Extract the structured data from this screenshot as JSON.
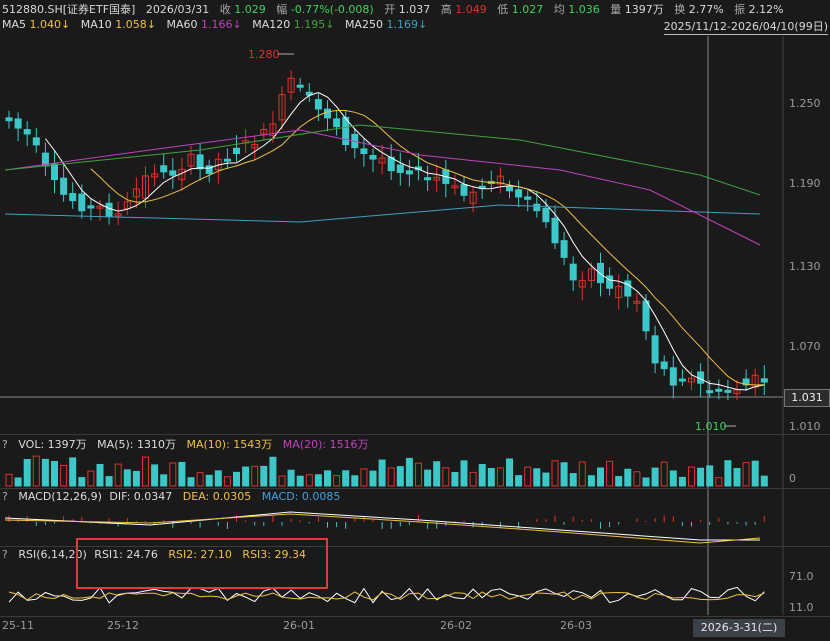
{
  "header": {
    "symbol": "512880.SH[证券ETF国泰]",
    "date": "2026/03/31",
    "close_label": "收",
    "close": "1.029",
    "change_label": "幅",
    "change": "-0.77%(-0.008)",
    "open_label": "开",
    "open": "1.037",
    "high_label": "高",
    "high": "1.049",
    "low_label": "低",
    "low": "1.027",
    "avg_label": "均",
    "avg": "1.036",
    "volume_label": "量",
    "volume": "1397万",
    "turnover_label": "换",
    "turnover": "2.77%",
    "amplitude_label": "振",
    "amplitude": "2.12%"
  },
  "ma_bar": {
    "ma5": "MA5",
    "ma5_val": "1.040↓",
    "ma10": "MA10",
    "ma10_val": "1.058↓",
    "ma60": "MA60",
    "ma60_val": "1.166↓",
    "ma120": "MA120",
    "ma120_val": "1.195↓",
    "ma250": "MA250",
    "ma250_val": "1.169↓",
    "range": "2025/11/12-2026/04/10(99日)"
  },
  "price_axis": [
    "1.250",
    "1.190",
    "1.130",
    "1.070",
    "1.010"
  ],
  "last_price_tag": "1.031",
  "hi_label": "1.280",
  "lo_label": "1.010",
  "volume_panel": {
    "title": "VOL: 1397万",
    "ma5": "MA(5): 1310万",
    "ma10": "MA(10): 1543万",
    "ma20": "MA(20): 1516万",
    "axis_zero": "0"
  },
  "macd_panel": {
    "title": "MACD(12,26,9)",
    "dif": "DIF: 0.0347",
    "dea": "DEA: 0.0305",
    "macd": "MACD: 0.0085"
  },
  "rsi_panel": {
    "title": "RSI(6,14,20)",
    "rsi1": "RSI1: 24.76",
    "rsi2": "RSI2: 27.10",
    "rsi3": "RSI3: 29.34",
    "axis_top": "71.0",
    "axis_bottom": "11.0"
  },
  "x_axis": [
    "25-11",
    "25-12",
    "26-01",
    "26-02",
    "26-03"
  ],
  "cursor_date": "2026-3-31(二)",
  "colors": {
    "up": "#e0312a",
    "down": "#3cc8c8",
    "ma5": "#ffffff",
    "ma10": "#f0c040",
    "ma60": "#c040c0",
    "ma120": "#40a040",
    "ma250": "#40a0c0",
    "background": "#1a1a1a",
    "label_up": "#e0312a",
    "label_down": "#3ad35c"
  }
}
